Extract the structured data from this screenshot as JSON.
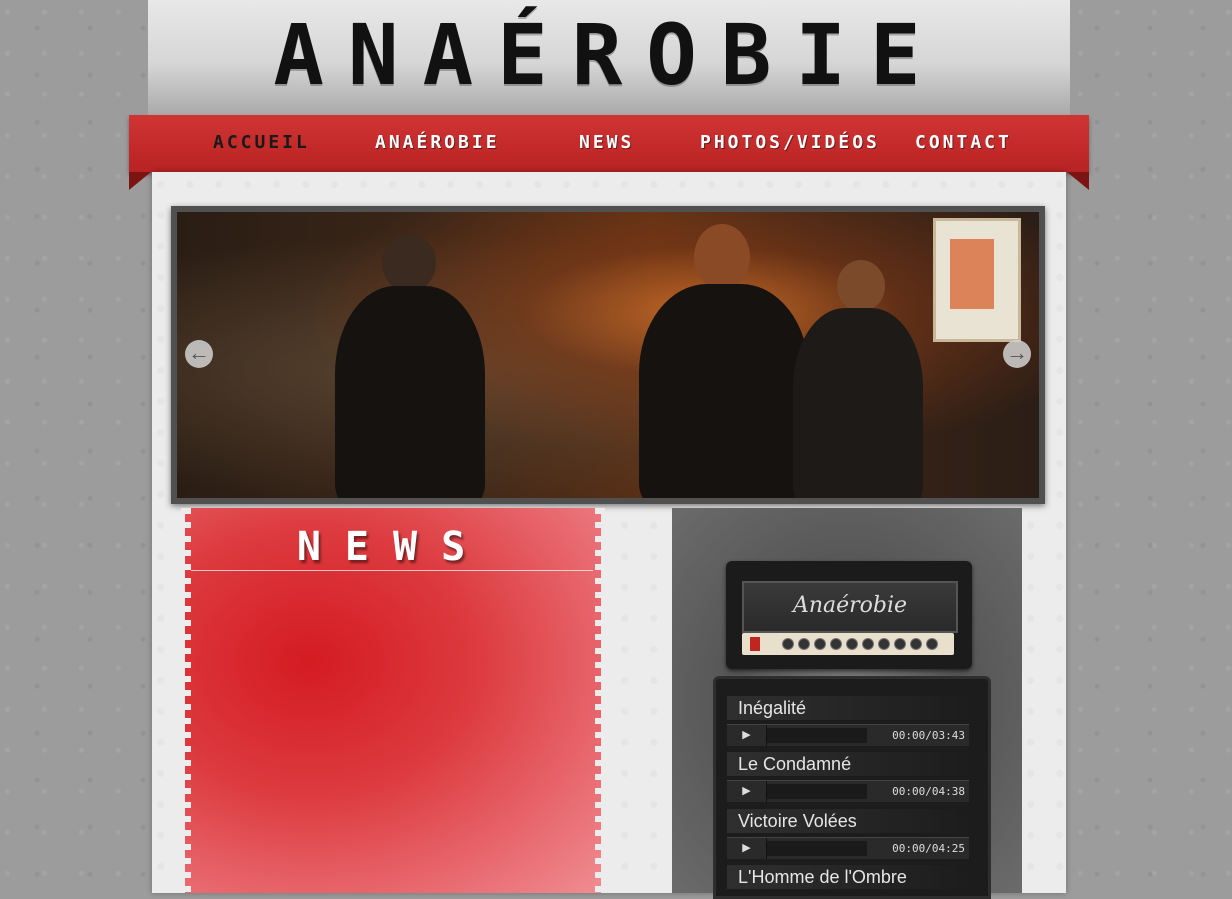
{
  "site": {
    "title": "ANAÉROBIE"
  },
  "nav": [
    {
      "label": "ACCUEIL",
      "active": true
    },
    {
      "label": "ANAÉROBIE",
      "active": false
    },
    {
      "label": "NEWS",
      "active": false
    },
    {
      "label": "PHOTOS/VIDÉOS",
      "active": false
    },
    {
      "label": "CONTACT",
      "active": false
    }
  ],
  "slider": {
    "prev_icon": "arrow-left-icon",
    "next_icon": "arrow-right-icon"
  },
  "news": {
    "title": "NEWS"
  },
  "player": {
    "amp_label": "Anaérobie",
    "tracks": [
      {
        "title": "Inégalité",
        "time": "00:00/03:43"
      },
      {
        "title": "Le Condamné",
        "time": "00:00/04:38"
      },
      {
        "title": "Victoire Volées",
        "time": "00:00/04:25"
      },
      {
        "title": "L'Homme de l'Ombre"
      }
    ]
  },
  "colors": {
    "accent": "#c42a2a",
    "page": "#ececec",
    "background": "#9c9c9c"
  }
}
